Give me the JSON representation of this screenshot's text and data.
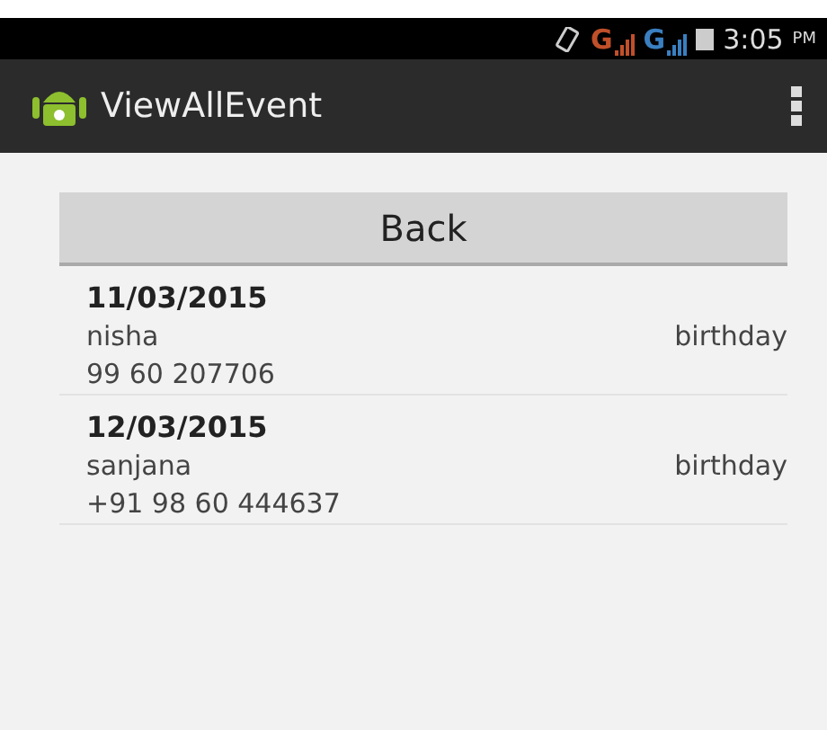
{
  "status_bar": {
    "networks": [
      {
        "label": "G",
        "color": "#c0502a"
      },
      {
        "label": "G",
        "color": "#3a7fc0"
      }
    ],
    "time": "3:05",
    "meridiem": "PM"
  },
  "action_bar": {
    "title": "ViewAllEvent"
  },
  "back_button": {
    "label": "Back"
  },
  "events": [
    {
      "date": "11/03/2015",
      "name": "nisha",
      "type": "birthday",
      "phone": "99 60 207706"
    },
    {
      "date": "12/03/2015",
      "name": "sanjana",
      "type": "birthday",
      "phone": "+91 98 60 444637"
    }
  ]
}
